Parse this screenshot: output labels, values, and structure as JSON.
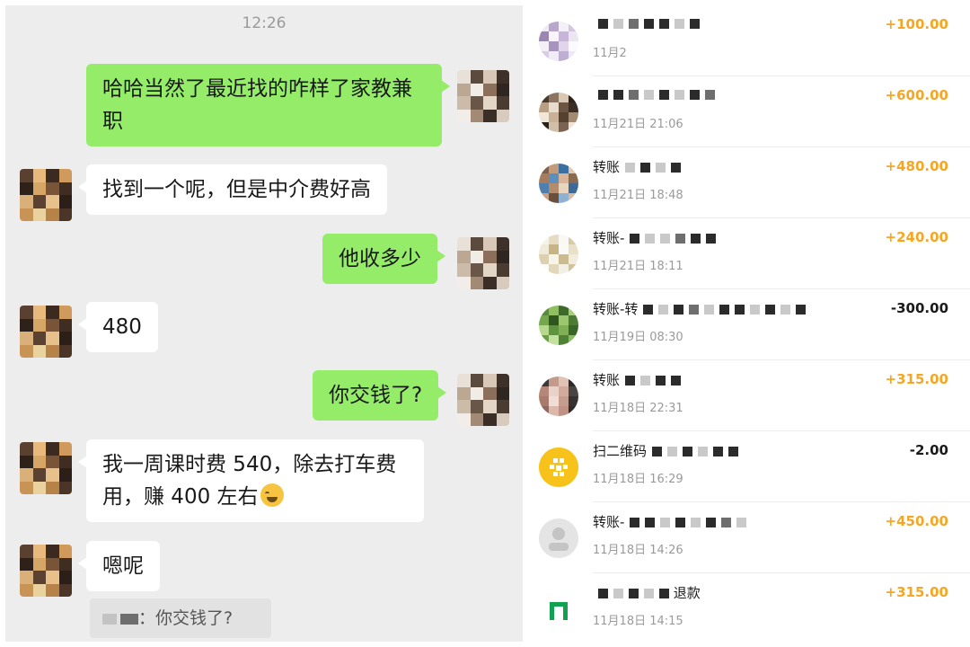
{
  "chat": {
    "time": "12:26",
    "messages": [
      {
        "from": "me",
        "text": "哈哈当然了最近找的咋样了家教兼职"
      },
      {
        "from": "other",
        "text": "找到一个呢，但是中介费好高"
      },
      {
        "from": "me",
        "text": "他收多少"
      },
      {
        "from": "other",
        "text": "480"
      },
      {
        "from": "me",
        "text": "你交钱了?"
      },
      {
        "from": "other",
        "text_line1": "我一周课时费 540，除去打车费",
        "text_line2": "用，赚 400 左右",
        "emoji": "crying-laughing-emoji"
      },
      {
        "from": "other",
        "text": "嗯呢"
      }
    ],
    "quote": {
      "text": "：你交钱了?"
    }
  },
  "bill": {
    "items": [
      {
        "title": "",
        "title_tail": "",
        "time": "11月2",
        "amount": "+100.00",
        "sign": "plus"
      },
      {
        "title": "",
        "title_tail": "",
        "time": "11月21日 21:06",
        "amount": "+600.00",
        "sign": "plus"
      },
      {
        "title": "转账",
        "title_tail": "",
        "time": "11月21日 18:48",
        "amount": "+480.00",
        "sign": "plus"
      },
      {
        "title": "转账-",
        "title_tail": "",
        "time": "11月21日 18:11",
        "amount": "+240.00",
        "sign": "plus"
      },
      {
        "title": "转账-转",
        "title_tail": "",
        "time": "11月19日 08:30",
        "amount": "-300.00",
        "sign": "minus"
      },
      {
        "title": "转账",
        "title_tail": "",
        "time": "11月18日 22:31",
        "amount": "+315.00",
        "sign": "plus"
      },
      {
        "title": "扫二维码",
        "title_tail": "",
        "time": "11月18日 16:29",
        "amount": "-2.00",
        "sign": "minus"
      },
      {
        "title": "转账-",
        "title_tail": "",
        "time": "11月18日 14:26",
        "amount": "+450.00",
        "sign": "plus"
      },
      {
        "title": "",
        "title_tail": "退款",
        "time": "11月18日 14:15",
        "amount": "+315.00",
        "sign": "plus"
      }
    ]
  },
  "colors": {
    "my_bubble": "#95ec69",
    "their_bubble": "#ffffff",
    "chat_bg": "#ededed",
    "income_amount": "#f5a623",
    "expense_amount": "#1b1b1b"
  }
}
